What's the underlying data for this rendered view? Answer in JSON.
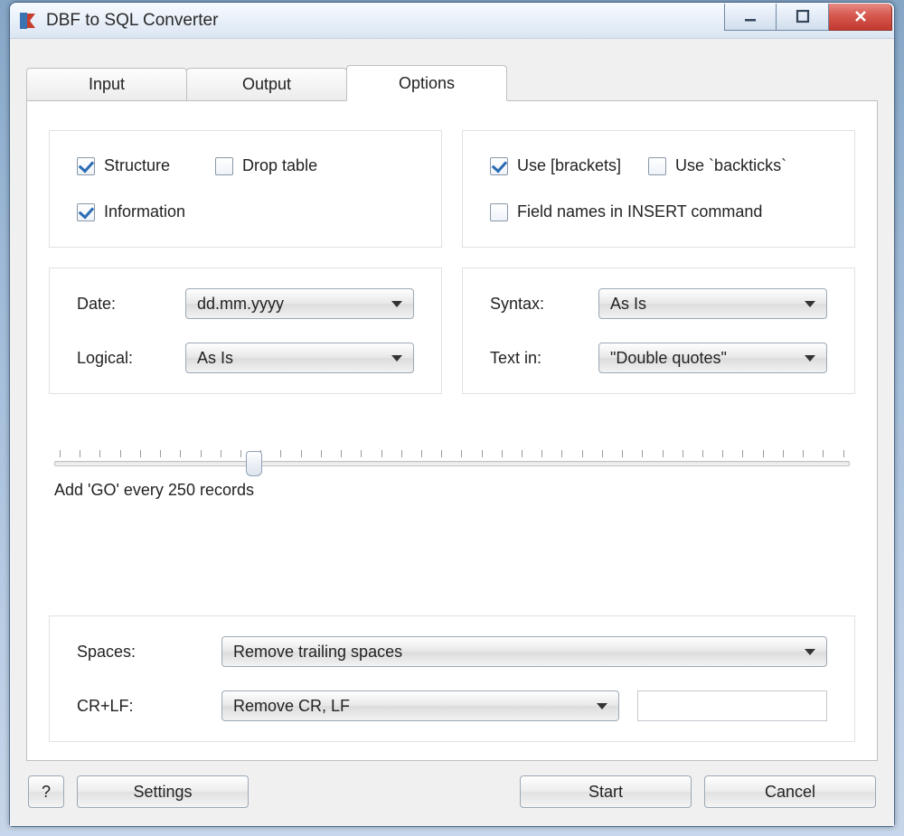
{
  "window": {
    "title": "DBF to SQL Converter"
  },
  "tabs": {
    "input": "Input",
    "output": "Output",
    "options": "Options"
  },
  "checks": {
    "structure": {
      "label": "Structure",
      "checked": true
    },
    "droptable": {
      "label": "Drop table",
      "checked": false
    },
    "information": {
      "label": "Information",
      "checked": true
    },
    "brackets": {
      "label": "Use [brackets]",
      "checked": true
    },
    "backticks": {
      "label": "Use `backticks`",
      "checked": false
    },
    "fieldnames": {
      "label": "Field names in INSERT command",
      "checked": false
    }
  },
  "selects": {
    "date": {
      "label": "Date:",
      "value": "dd.mm.yyyy"
    },
    "logical": {
      "label": "Logical:",
      "value": "As Is"
    },
    "syntax": {
      "label": "Syntax:",
      "value": "As Is"
    },
    "textin": {
      "label": "Text in:",
      "value": "\"Double quotes\""
    },
    "spaces": {
      "label": "Spaces:",
      "value": "Remove trailing spaces"
    },
    "crlf": {
      "label": "CR+LF:",
      "value": "Remove CR, LF"
    }
  },
  "slider": {
    "caption": "Add 'GO' every 250 records",
    "percent": 25
  },
  "buttons": {
    "help": "?",
    "settings": "Settings",
    "start": "Start",
    "cancel": "Cancel"
  }
}
